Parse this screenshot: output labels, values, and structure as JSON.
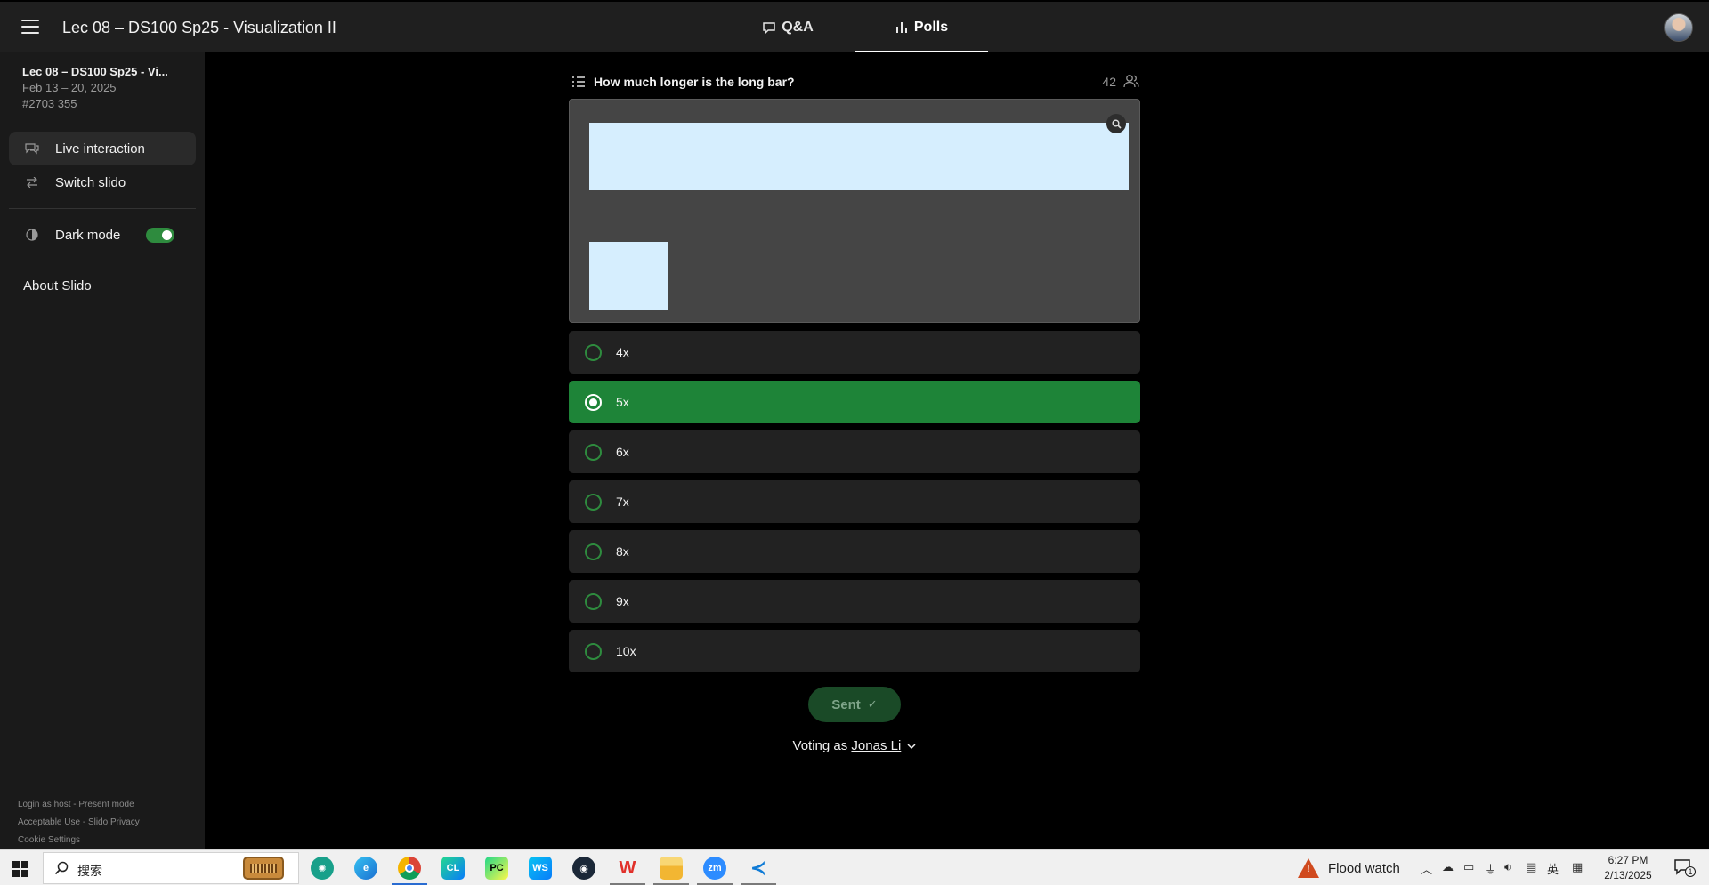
{
  "header": {
    "event_title": "Lec 08 – DS100 Sp25 - Visualization II",
    "tabs": [
      {
        "label": "Q&A",
        "icon": "chat-bubble-icon"
      },
      {
        "label": "Polls",
        "icon": "bar-chart-icon",
        "active": true
      }
    ]
  },
  "sidebar": {
    "event_name": "Lec 08 – DS100 Sp25 - Vi...",
    "event_dates": "Feb 13 – 20, 2025",
    "event_code": "#2703 355",
    "items": [
      {
        "label": "Live interaction",
        "icon": "chat-icon",
        "active": true
      },
      {
        "label": "Switch slido",
        "icon": "swap-icon"
      }
    ],
    "dark_mode_label": "Dark mode",
    "dark_mode_on": true,
    "about_label": "About Slido",
    "footer": {
      "login_host": "Login as host",
      "sep1": " - ",
      "present_mode": "Present mode",
      "acceptable_use": "Acceptable Use",
      "sep2": " - ",
      "privacy": "Slido Privacy",
      "cookie_settings": "Cookie Settings"
    }
  },
  "poll": {
    "question": "How much longer is the long bar?",
    "participants": "42",
    "options": [
      {
        "label": "4x",
        "selected": false
      },
      {
        "label": "5x",
        "selected": true
      },
      {
        "label": "6x",
        "selected": false
      },
      {
        "label": "7x",
        "selected": false
      },
      {
        "label": "8x",
        "selected": false
      },
      {
        "label": "9x",
        "selected": false
      },
      {
        "label": "10x",
        "selected": false
      }
    ],
    "sent_label": "Sent",
    "voting_as_prefix": "Voting as ",
    "voter_name": "Jonas Li"
  },
  "colors": {
    "accent_green": "#1e8438",
    "bar_fill": "#d6eefe",
    "warning_orange": "#d04a1e"
  },
  "taskbar": {
    "search_placeholder": "搜索",
    "apps": [
      "chatgpt-icon",
      "edge-icon",
      "chrome-icon",
      "clion-icon",
      "pycharm-icon",
      "webstorm-icon",
      "steam-icon",
      "wps-icon",
      "file-explorer-icon",
      "zoom-icon",
      "vscode-icon"
    ],
    "weather_alert": "Flood watch",
    "ime_label": "英",
    "time": "6:27 PM",
    "date": "2/13/2025",
    "notification_count": "1"
  }
}
